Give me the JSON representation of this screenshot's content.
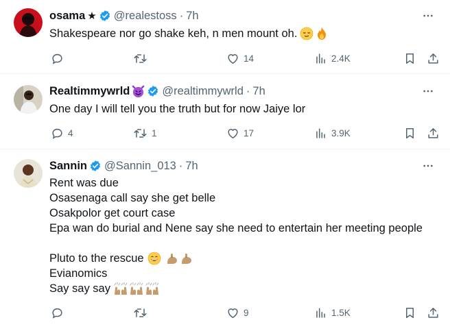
{
  "tweets": [
    {
      "name": "osama",
      "name_suffix": "★",
      "handle": "@realestoss",
      "dot": "·",
      "time": "7h",
      "lines": [
        "Shakespeare nor go shake keh, n men mount oh."
      ],
      "replies": "",
      "retweets": "",
      "likes": "14",
      "views": "2.4K"
    },
    {
      "name": "Realtimmywrld",
      "handle": "@realtimmywrld",
      "dot": "·",
      "time": "7h",
      "lines": [
        "One day I will tell you the truth but for now Jaiye lor"
      ],
      "replies": "4",
      "retweets": "1",
      "likes": "17",
      "views": "3.9K"
    },
    {
      "name": "Sannin",
      "handle": "@Sannin_013",
      "dot": "·",
      "time": "7h",
      "lines": [
        "Rent was due",
        "Osasenaga call say she get belle",
        "Osakpolor get court case",
        "Epa wan do burial and Nene say she need to entertain her meeting people",
        "",
        "Pluto to the rescue",
        "Evianomics",
        "Say say say"
      ],
      "replies": "",
      "retweets": "",
      "likes": "9",
      "views": "1.5K"
    }
  ],
  "icons": {
    "verified": "verified-badge-icon",
    "more": "more-icon",
    "reply": "reply-icon",
    "retweet": "retweet-icon",
    "like": "like-icon",
    "views": "views-icon",
    "bookmark": "bookmark-icon",
    "share": "share-icon"
  },
  "colors": {
    "text": "#0f1419",
    "secondary": "#536471",
    "verified": "#1d9bf0",
    "divider": "#eff3f4"
  }
}
